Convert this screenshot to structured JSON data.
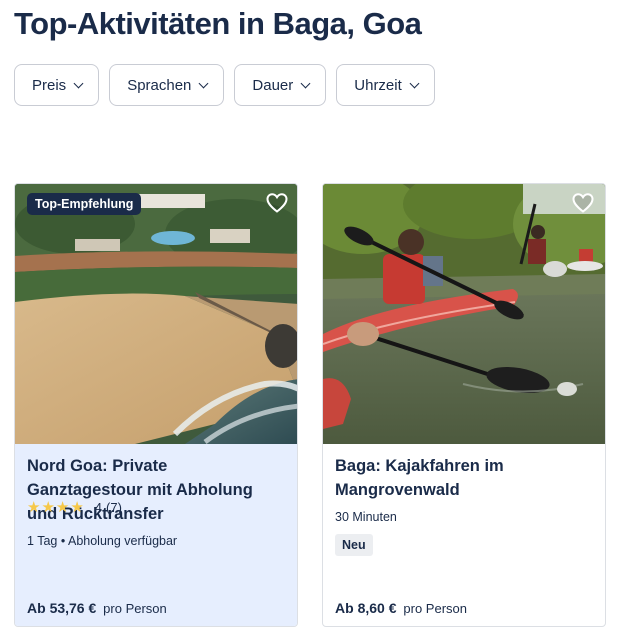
{
  "header": {
    "title": "Top-Aktivitäten in Baga, Goa"
  },
  "filters": [
    {
      "label": "Preis"
    },
    {
      "label": "Sprachen"
    },
    {
      "label": "Dauer"
    },
    {
      "label": "Uhrzeit"
    }
  ],
  "cards": [
    {
      "badge": "Top-Empfehlung",
      "title_lines": [
        "Nord Goa: Private",
        "Ganztagestour mit Abholung",
        "und Rücktransfer"
      ],
      "meta": "1 Tag • Abholung verfügbar",
      "rating_stars": 4,
      "rating_value": "4",
      "rating_count": "(7)",
      "price_prefix": "Ab",
      "price": "53,76 €",
      "price_unit": "pro Person"
    },
    {
      "title_lines": [
        "Baga: Kajakfahren im",
        "Mangrovenwald"
      ],
      "meta": "30 Minuten",
      "tag": "Neu",
      "price_prefix": "Ab",
      "price": "8,60 €",
      "price_unit": "pro Person"
    }
  ],
  "colors": {
    "text": "#1a2b49",
    "star": "#f6c84a",
    "card_highlight_bg": "#e6eefe",
    "badge_bg": "#1a2b49"
  },
  "icons": {
    "filter_chevron": "chevron-down-icon",
    "wishlist": "heart-icon",
    "rating": "star-icon"
  }
}
